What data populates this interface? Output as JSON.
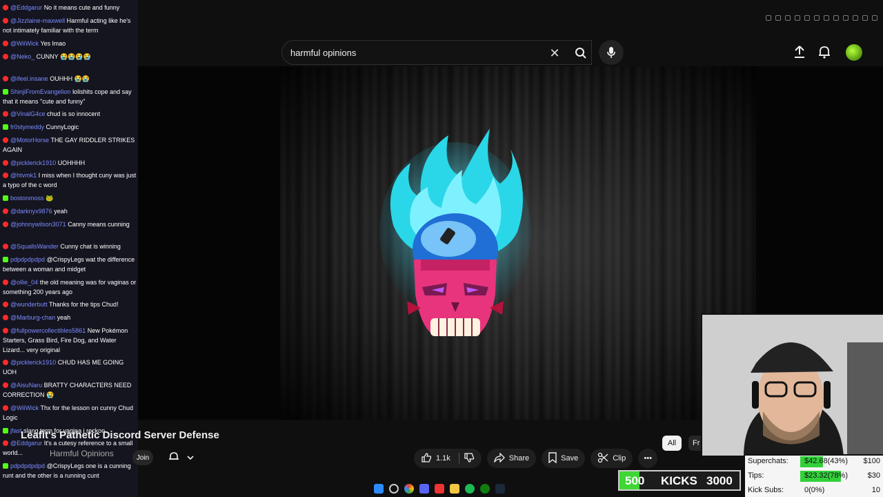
{
  "search": {
    "query": "harmful opinions"
  },
  "video": {
    "title": "Leafit's Pathetic Discord Server Defense",
    "channel": "Harmful Opinions",
    "join_label": "Join",
    "likes": "1.1k",
    "share_label": "Share",
    "save_label": "Save",
    "clip_label": "Clip",
    "more_label": "•••"
  },
  "chips": {
    "all": "All",
    "fr": "Fr"
  },
  "chat": [
    {
      "platform": "yt",
      "user": "@Eddgarur",
      "text": "No it means cute and funny"
    },
    {
      "platform": "yt",
      "user": "@Jizzlaine-maxwell",
      "text": "Harmful acting like he's not intimately familiar with the term"
    },
    {
      "platform": "yt",
      "user": "@WiiWick",
      "text": "Yes lmao"
    },
    {
      "platform": "yt",
      "user": "@Neko_",
      "text": "CUNNY 😭😭😭😭"
    },
    {
      "platform": "yt",
      "user": "@ifeel.insane",
      "text": "OUHHH 😭😭"
    },
    {
      "platform": "kk",
      "user": "ShinjiFromEvangelion",
      "text": "lolishits cope and say that it means \"cute and funny\""
    },
    {
      "platform": "yt",
      "user": "@VinalG4ce",
      "text": "chud is so innocent"
    },
    {
      "platform": "kk",
      "user": "fr0stymeddy",
      "text": "CunnyLogic"
    },
    {
      "platform": "yt",
      "user": "@MotorHorse",
      "text": "THE GAY RIDDLER STRIKES AGAIN"
    },
    {
      "platform": "yt",
      "user": "@picklerick1910",
      "text": "UOHHHH"
    },
    {
      "platform": "yt",
      "user": "@htvmk1",
      "text": "I miss when I thought cuny was just a typo of the c word"
    },
    {
      "platform": "kk",
      "user": "bostonmoss",
      "text": "🐸"
    },
    {
      "platform": "yt",
      "user": "@darknyx9876",
      "text": "yeah"
    },
    {
      "platform": "yt",
      "user": "@johnnywilson3071",
      "text": "Canny means cunning"
    },
    {
      "platform": "yt",
      "user": "@SquallsWander",
      "text": "Cunny chat is winning"
    },
    {
      "platform": "kk",
      "user": "pdpdpdpdpd",
      "text": "@CrispyLegs wat the difference between a woman and midget"
    },
    {
      "platform": "yt",
      "user": "@ollie_04",
      "text": "the old meaning was for vaginas or something 200 years ago"
    },
    {
      "platform": "yt",
      "user": "@wunderbutt",
      "text": "Thanks for the tips Chud!"
    },
    {
      "platform": "yt",
      "user": "@Marburg-chan",
      "text": "yeah"
    },
    {
      "platform": "yt",
      "user": "@fullpowercollectibles5861",
      "text": "New Pokémon Starters, Grass Bird, Fire Dog, and Water Lizard... very original"
    },
    {
      "platform": "yt",
      "user": "@picklerick1910",
      "text": "CHUD HAS ME GOING UOH"
    },
    {
      "platform": "yt",
      "user": "@AisuNaru",
      "text": "BRATTY CHARACTERS NEED CORRECTION 😭"
    },
    {
      "platform": "yt",
      "user": "@WiiWick",
      "text": "Thx for the lesson on cunny Chud Logic"
    },
    {
      "platform": "kk",
      "user": "jfast",
      "text": "slang term for vagina i reckon"
    },
    {
      "platform": "yt",
      "user": "@Eddgarur",
      "text": "It's a cutesy reference to a small world..."
    },
    {
      "platform": "kk",
      "user": "pdpdpdpdpd",
      "text": "@CrispyLegs one is a cunning runt and the other is a running cunt"
    }
  ],
  "stats": {
    "superchats_label": "Superchats:",
    "superchats_value": "$42.68(43%)",
    "superchats_goal": "$100",
    "superchats_progress": 0.43,
    "tips_label": "Tips:",
    "tips_value": "$23.32(78%)",
    "tips_goal": "$30",
    "tips_progress": 0.78,
    "kicksubs_label": "Kick Subs:",
    "kicksubs_value": "0(0%)",
    "kicksubs_goal": "10",
    "kicksubs_progress": 0
  },
  "kicks": {
    "current": "500",
    "label": "KICKS",
    "goal": "3000"
  },
  "colors": {
    "accent_green": "#3fd636",
    "yt_red": "#ff2b2b",
    "kick_green": "#53fc18"
  }
}
